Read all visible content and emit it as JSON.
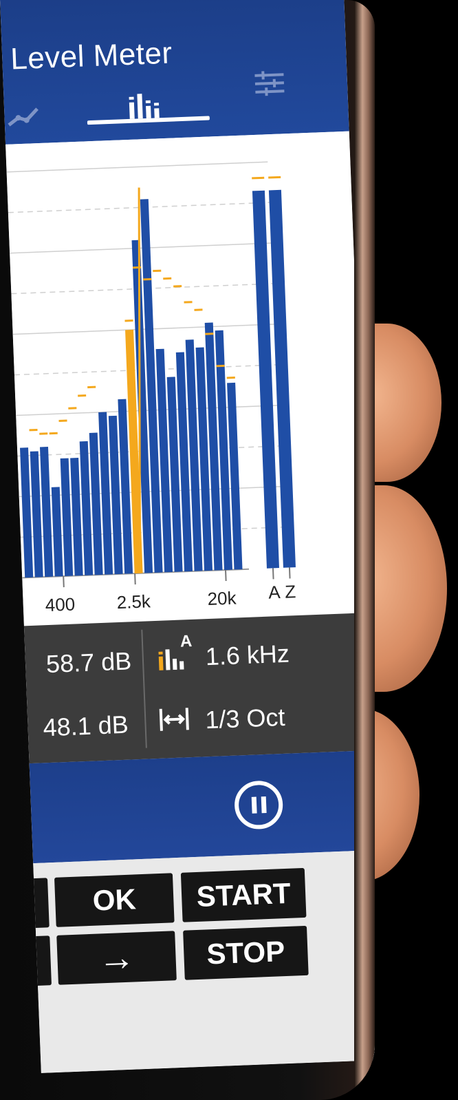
{
  "app": {
    "title": "Level Meter"
  },
  "tabs": [
    {
      "icon": "trend-line-icon"
    },
    {
      "icon": "spectrum-bars-icon",
      "active": true
    },
    {
      "icon": "equalizer-sliders-icon"
    }
  ],
  "spectrum": {
    "x_tick_labels": [
      "400",
      "2.5k",
      "20k"
    ],
    "overall_labels": [
      "A",
      "Z"
    ],
    "bar_levels_percent": [
      32,
      31,
      32,
      22,
      29,
      29,
      33,
      35,
      40,
      39,
      43,
      60,
      82,
      92,
      55,
      48,
      54,
      57,
      55,
      61,
      59,
      46
    ],
    "peak_hold_percent": [
      null,
      36,
      35,
      35,
      38,
      41,
      44,
      46,
      null,
      null,
      null,
      62,
      75,
      72,
      74,
      72,
      70,
      66,
      64,
      58,
      50,
      47
    ],
    "overall_bars_percent": [
      93,
      93
    ],
    "highlighted_band_index": 11,
    "accent_color": "#f4a81d",
    "bar_color": "#1f4ea6"
  },
  "readouts": {
    "level_1": "58.7 dB",
    "level_2": "48.1 dB",
    "band_freq_label": "A",
    "band_freq": "1.6 kHz",
    "bandwidth": "1/3 Oct"
  },
  "keypad": {
    "ok": "OK",
    "start": "START",
    "stop": "STOP",
    "arrow": "→"
  }
}
